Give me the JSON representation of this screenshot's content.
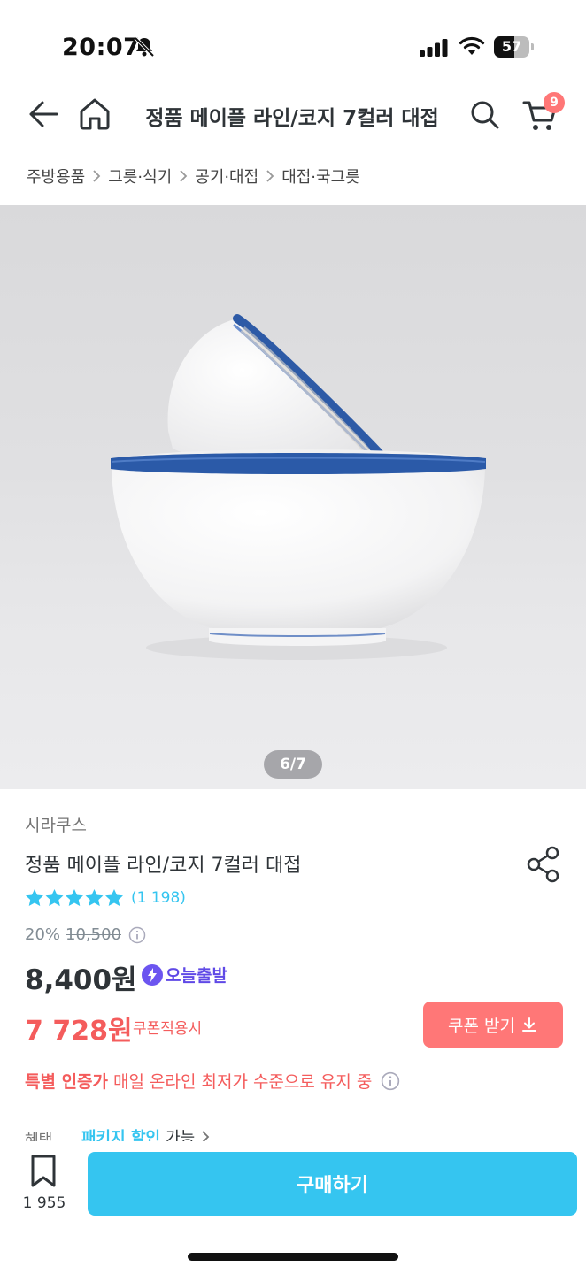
{
  "status": {
    "time": "20:07",
    "battery": "57",
    "battery_level": 0.57
  },
  "nav": {
    "title": "정품 메이플 라인/코지 7컬러 대접",
    "cart_count": "9"
  },
  "breadcrumb": [
    "주방용품",
    "그릇·식기",
    "공기·대접",
    "대접·국그릇"
  ],
  "gallery": {
    "counter": "6/7"
  },
  "product": {
    "brand": "시라쿠스",
    "name": "정품 메이플 라인/코지 7컬러 대접",
    "rating": 5,
    "reviews": "(1 198)",
    "discount": "20%",
    "original_price": "10,500",
    "price": "8,400원",
    "delivery_badge": "오늘출발",
    "coupon_price": "7 728원",
    "coupon_note": "쿠폰적용시",
    "coupon_button": "쿠폰 받기",
    "special_bold": "특별 인증가",
    "special_text": "매일 온라인 최저가 수준으로 유지 중",
    "benefit_label": "혜택",
    "benefit_highlight": "패키지 할인",
    "benefit_text": "가능"
  },
  "bottom": {
    "bookmark_count": "1 955",
    "buy_label": "구매하기"
  },
  "colors": {
    "accent": "#35c5f0",
    "coupon": "#ff7777",
    "sale": "#f45c5c",
    "today": "#5f49e6"
  }
}
